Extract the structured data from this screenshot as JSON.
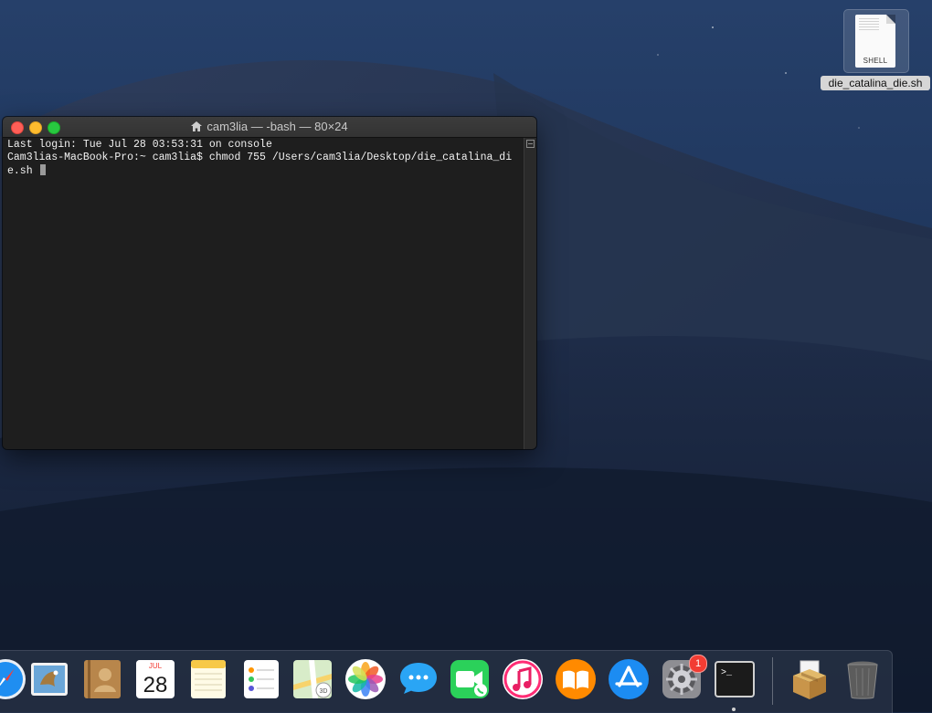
{
  "desktop": {
    "file": {
      "name": "die_catalina_die.sh",
      "kind": "SHELL"
    }
  },
  "terminal": {
    "title": "cam3lia — -bash — 80×24",
    "lines": [
      "Last login: Tue Jul 28 03:53:31 on console",
      "Cam3lias-MacBook-Pro:~ cam3lia$ chmod 755 /Users/cam3lia/Desktop/die_catalina_di",
      "e.sh "
    ]
  },
  "dock": {
    "calendar": {
      "month": "JUL",
      "day": "28"
    },
    "system_preferences_badge": "1",
    "terminal_prompt": ">_"
  },
  "icons": {
    "safari": "safari-icon",
    "mail": "mail-icon",
    "contacts": "contacts-icon",
    "calendar": "calendar-icon",
    "notes": "notes-icon",
    "reminders": "reminders-icon",
    "maps": "maps-icon",
    "photos": "photos-icon",
    "messages": "messages-icon",
    "facetime": "facetime-icon",
    "itunes": "itunes-icon",
    "books": "books-icon",
    "app_store": "app-store-icon",
    "system_preferences": "gear-icon",
    "terminal": "terminal-icon",
    "installer": "package-icon",
    "trash": "trash-icon"
  },
  "colors": {
    "close": "#ff5f57",
    "minimize": "#febc2e",
    "zoom": "#28c840",
    "terminal_bg": "#1e1e1e",
    "badge": "#f23c33"
  }
}
